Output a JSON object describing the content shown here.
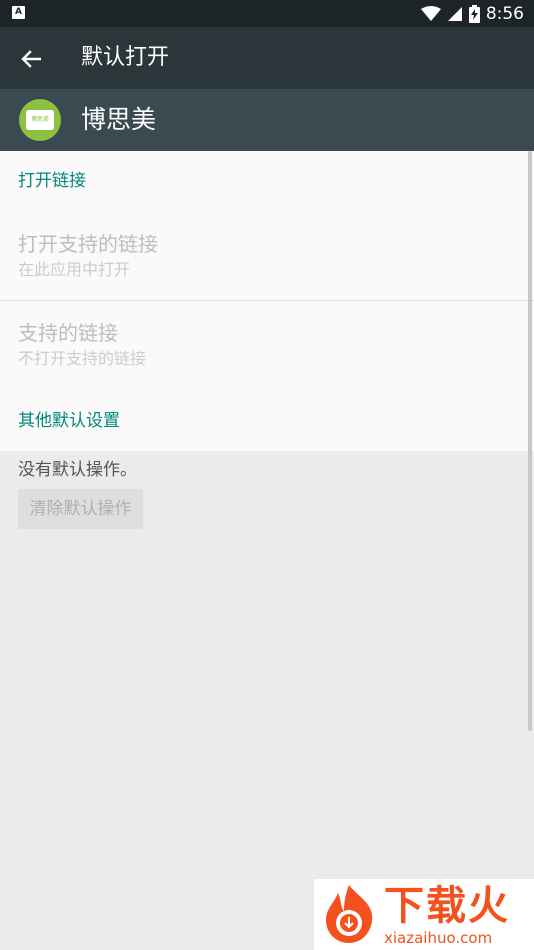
{
  "status_bar": {
    "time": "8:56",
    "icons": [
      "notification-a-icon",
      "wifi-icon",
      "signal-icon",
      "battery-charging-icon"
    ]
  },
  "toolbar": {
    "title": "默认打开",
    "back_icon": "arrow-back-icon"
  },
  "app": {
    "name": "博思美",
    "icon_label": "博思美",
    "icon_color": "#8cc23f"
  },
  "open_links": {
    "section_title": "打开链接",
    "open_supported": {
      "title": "打开支持的链接",
      "summary": "在此应用中打开"
    },
    "supported_links": {
      "title": "支持的链接",
      "summary": "不打开支持的链接"
    }
  },
  "other_defaults": {
    "section_title": "其他默认设置",
    "status_text": "没有默认操作。",
    "clear_button": "清除默认操作"
  },
  "watermark": {
    "text": "下载火",
    "url": "xiazaihuo.com"
  },
  "colors": {
    "accent": "#00897b",
    "toolbar": "#2b363b",
    "app_header": "#3a4a50",
    "watermark": "#f4511e"
  }
}
